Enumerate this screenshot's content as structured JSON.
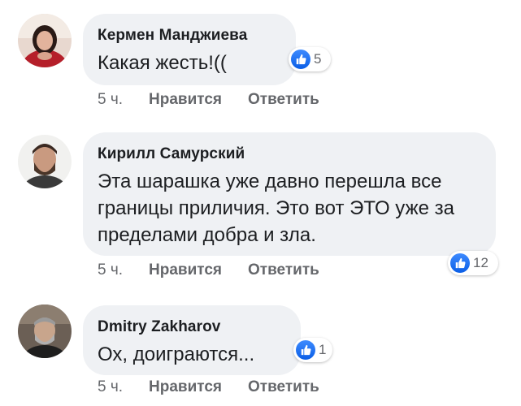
{
  "comments": [
    {
      "author": "Кермен Манджиева",
      "text": "Какая жесть!((",
      "reactions": "5",
      "time": "5 ч.",
      "like_label": "Нравится",
      "reply_label": "Ответить"
    },
    {
      "author": "Кирилл Самурский",
      "text": "Эта шарашка уже давно перешла все границы приличия. Это вот ЭТО уже за пределами добра и зла.",
      "reactions": "12",
      "time": "5 ч.",
      "like_label": "Нравится",
      "reply_label": "Ответить"
    },
    {
      "author": "Dmitry Zakharov",
      "text": "Ох, доиграются...",
      "reactions": "1",
      "time": "5 ч.",
      "like_label": "Нравится",
      "reply_label": "Ответить"
    }
  ],
  "colors": {
    "bubble": "#eff1f4",
    "like_blue": "#1877f2",
    "meta_text": "#65676b",
    "body_text": "#1c1e21"
  },
  "icons": {
    "reaction": "like-thumbs-up-icon"
  }
}
